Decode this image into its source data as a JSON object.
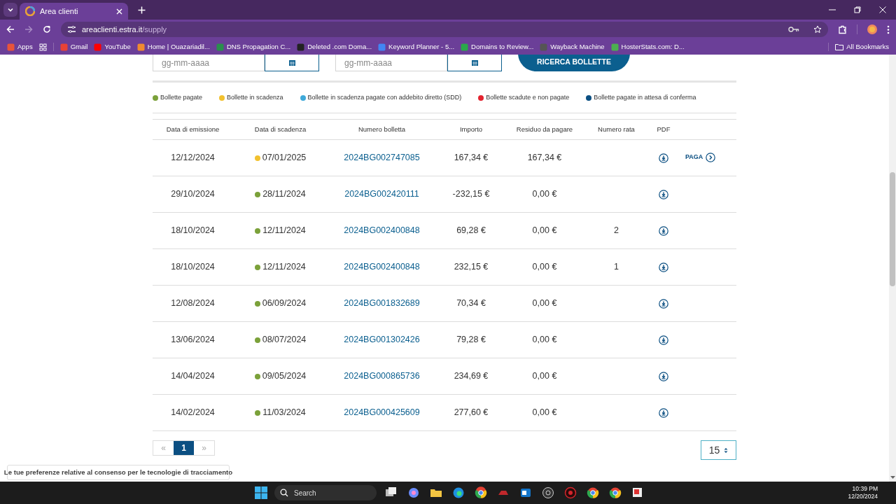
{
  "browser": {
    "tab": {
      "title": "Area clienti"
    },
    "url": {
      "host": "areaclienti.estra.it",
      "path": "/supply"
    },
    "bookmarks": [
      {
        "label": "Apps"
      },
      {
        "label": "Gmail"
      },
      {
        "label": "YouTube"
      },
      {
        "label": "Home | Ouazariadil..."
      },
      {
        "label": "DNS Propagation C..."
      },
      {
        "label": "Deleted .com Doma..."
      },
      {
        "label": "Keyword Planner - 5..."
      },
      {
        "label": "Domains to Review..."
      },
      {
        "label": "Wayback Machine"
      },
      {
        "label": "HosterStats.com: D..."
      }
    ],
    "all_bookmarks": "All Bookmarks"
  },
  "filters": {
    "date_from": {
      "placeholder": "gg-mm-aaaa"
    },
    "date_to": {
      "placeholder": "gg-mm-aaaa"
    },
    "search_button": "RICERCA BOLLETTE"
  },
  "legend": [
    {
      "label": "Bollette pagate",
      "color": "#7ba13a"
    },
    {
      "label": "Bollette in scadenza",
      "color": "#f2c12e"
    },
    {
      "label": "Bollette in scadenza pagate con addebito diretto (SDD)",
      "color": "#3fa9d9"
    },
    {
      "label": "Bollette scadute e non pagate",
      "color": "#e3232f"
    },
    {
      "label": "Bollette pagate in attesa di conferma",
      "color": "#0b4f82"
    }
  ],
  "table": {
    "columns": [
      "Data di emissione",
      "Data di scadenza",
      "Numero bolletta",
      "Importo",
      "Residuo da pagare",
      "Numero rata",
      "PDF"
    ],
    "rows": [
      {
        "issued": "12/12/2024",
        "due": "07/01/2025",
        "color": "#f2c12e",
        "number": "2024BG002747085",
        "amount": "167,34 €",
        "remaining": "167,34 €",
        "pay_action": "PAGA"
      },
      {
        "issued": "29/10/2024",
        "due": "28/11/2024",
        "color": "#7ba13a",
        "number": "2024BG002420111",
        "amount": "-232,15 €",
        "remaining": "0,00 €"
      },
      {
        "issued": "18/10/2024",
        "due": "12/11/2024",
        "color": "#7ba13a",
        "number": "2024BG002400848",
        "amount": "69,28 €",
        "remaining": "0,00 €",
        "installment": "2"
      },
      {
        "issued": "18/10/2024",
        "due": "12/11/2024",
        "color": "#7ba13a",
        "number": "2024BG002400848",
        "amount": "232,15 €",
        "remaining": "0,00 €",
        "installment": "1"
      },
      {
        "issued": "12/08/2024",
        "due": "06/09/2024",
        "color": "#7ba13a",
        "number": "2024BG001832689",
        "amount": "70,34 €",
        "remaining": "0,00 €"
      },
      {
        "issued": "13/06/2024",
        "due": "08/07/2024",
        "color": "#7ba13a",
        "number": "2024BG001302426",
        "amount": "79,28 €",
        "remaining": "0,00 €"
      },
      {
        "issued": "14/04/2024",
        "due": "09/05/2024",
        "color": "#7ba13a",
        "number": "2024BG000865736",
        "amount": "234,69 €",
        "remaining": "0,00 €"
      },
      {
        "issued": "14/02/2024",
        "due": "11/03/2024",
        "color": "#7ba13a",
        "number": "2024BG000425609",
        "amount": "277,60 €",
        "remaining": "0,00 €"
      }
    ]
  },
  "pagination": {
    "prev": "«",
    "next": "»",
    "pages": [
      {
        "label": "1",
        "selected": true
      }
    ]
  },
  "page_size": "15",
  "cookie_banner": "Le tue preferenze relative al consenso per le tecnologie di tracciamento",
  "taskbar": {
    "search": "Search",
    "time": "10:39 PM",
    "date": "12/20/2024"
  }
}
